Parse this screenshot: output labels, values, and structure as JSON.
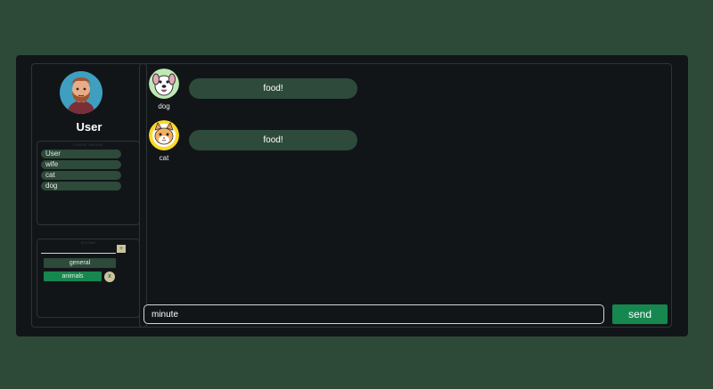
{
  "sidebar": {
    "username": "User",
    "users_panel": {
      "title": "USERS ONLINE",
      "users": [
        "User",
        "wife",
        "cat",
        "dog"
      ]
    },
    "rooms_panel": {
      "title": "ROOMS",
      "add_label": "+",
      "rooms": [
        "general",
        "animals"
      ],
      "active_room": "animals",
      "remove_label": "x"
    }
  },
  "chat": {
    "messages": [
      {
        "sender": "dog",
        "text": "food!"
      },
      {
        "sender": "cat",
        "text": "food!"
      }
    ],
    "input_value": "minute",
    "send_label": "send"
  },
  "colors": {
    "background": "#2d4a38",
    "app_bg": "#111518",
    "bubble": "#2e4a3a",
    "accent": "#16874f"
  }
}
